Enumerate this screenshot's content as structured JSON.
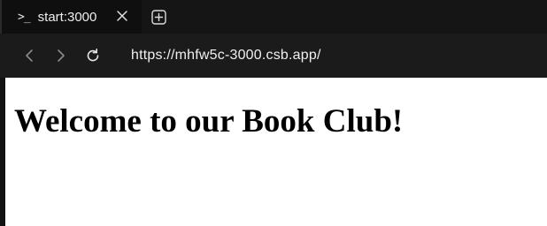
{
  "tab": {
    "icon": "terminal-prompt-icon",
    "label": "start:3000",
    "close_icon": "close-icon"
  },
  "new_tab_icon": "plus-square-icon",
  "nav": {
    "back_icon": "chevron-left-icon",
    "forward_icon": "chevron-right-icon",
    "reload_icon": "reload-icon",
    "url": "https://mhfw5c-3000.csb.app/"
  },
  "page": {
    "heading": "Welcome to our Book Club!"
  },
  "colors": {
    "chrome_bg": "#151515",
    "active_tab_bg": "#0f0f0f",
    "navbar_bg": "#1b1b1b",
    "page_bg": "#ffffff",
    "chrome_text": "#ededed"
  }
}
